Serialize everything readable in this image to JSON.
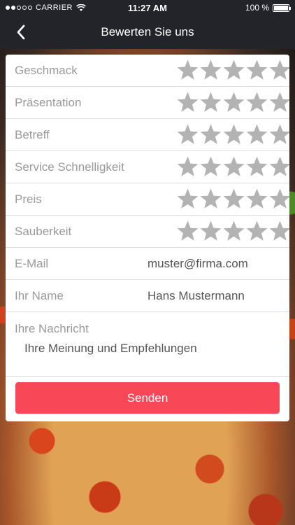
{
  "status_bar": {
    "carrier": "CARRIER",
    "time": "11:27 AM",
    "battery_percent": "100 %",
    "battery_level": 1.0
  },
  "nav": {
    "title": "Bewerten Sie uns",
    "back_icon": "chevron-left-icon"
  },
  "ratings": [
    {
      "label": "Geschmack",
      "stars_total": 5,
      "stars_selected": 0
    },
    {
      "label": "Präsentation",
      "stars_total": 5,
      "stars_selected": 0
    },
    {
      "label": "Betreff",
      "stars_total": 5,
      "stars_selected": 0
    },
    {
      "label": "Service Schnelligkeit",
      "stars_total": 5,
      "stars_selected": 0
    },
    {
      "label": "Preis",
      "stars_total": 5,
      "stars_selected": 0
    },
    {
      "label": "Sauberkeit",
      "stars_total": 5,
      "stars_selected": 0
    }
  ],
  "fields": {
    "email": {
      "label": "E-Mail",
      "placeholder": "muster@firma.com"
    },
    "name": {
      "label": "Ihr Name",
      "placeholder": "Hans Mustermann"
    },
    "message": {
      "label": "Ihre Nachricht",
      "placeholder": "Ihre Meinung und Empfehlungen"
    }
  },
  "submit_label": "Senden",
  "colors": {
    "accent": "#f84858",
    "star_empty": "#b3b3b3",
    "navbar": "#23242a"
  }
}
